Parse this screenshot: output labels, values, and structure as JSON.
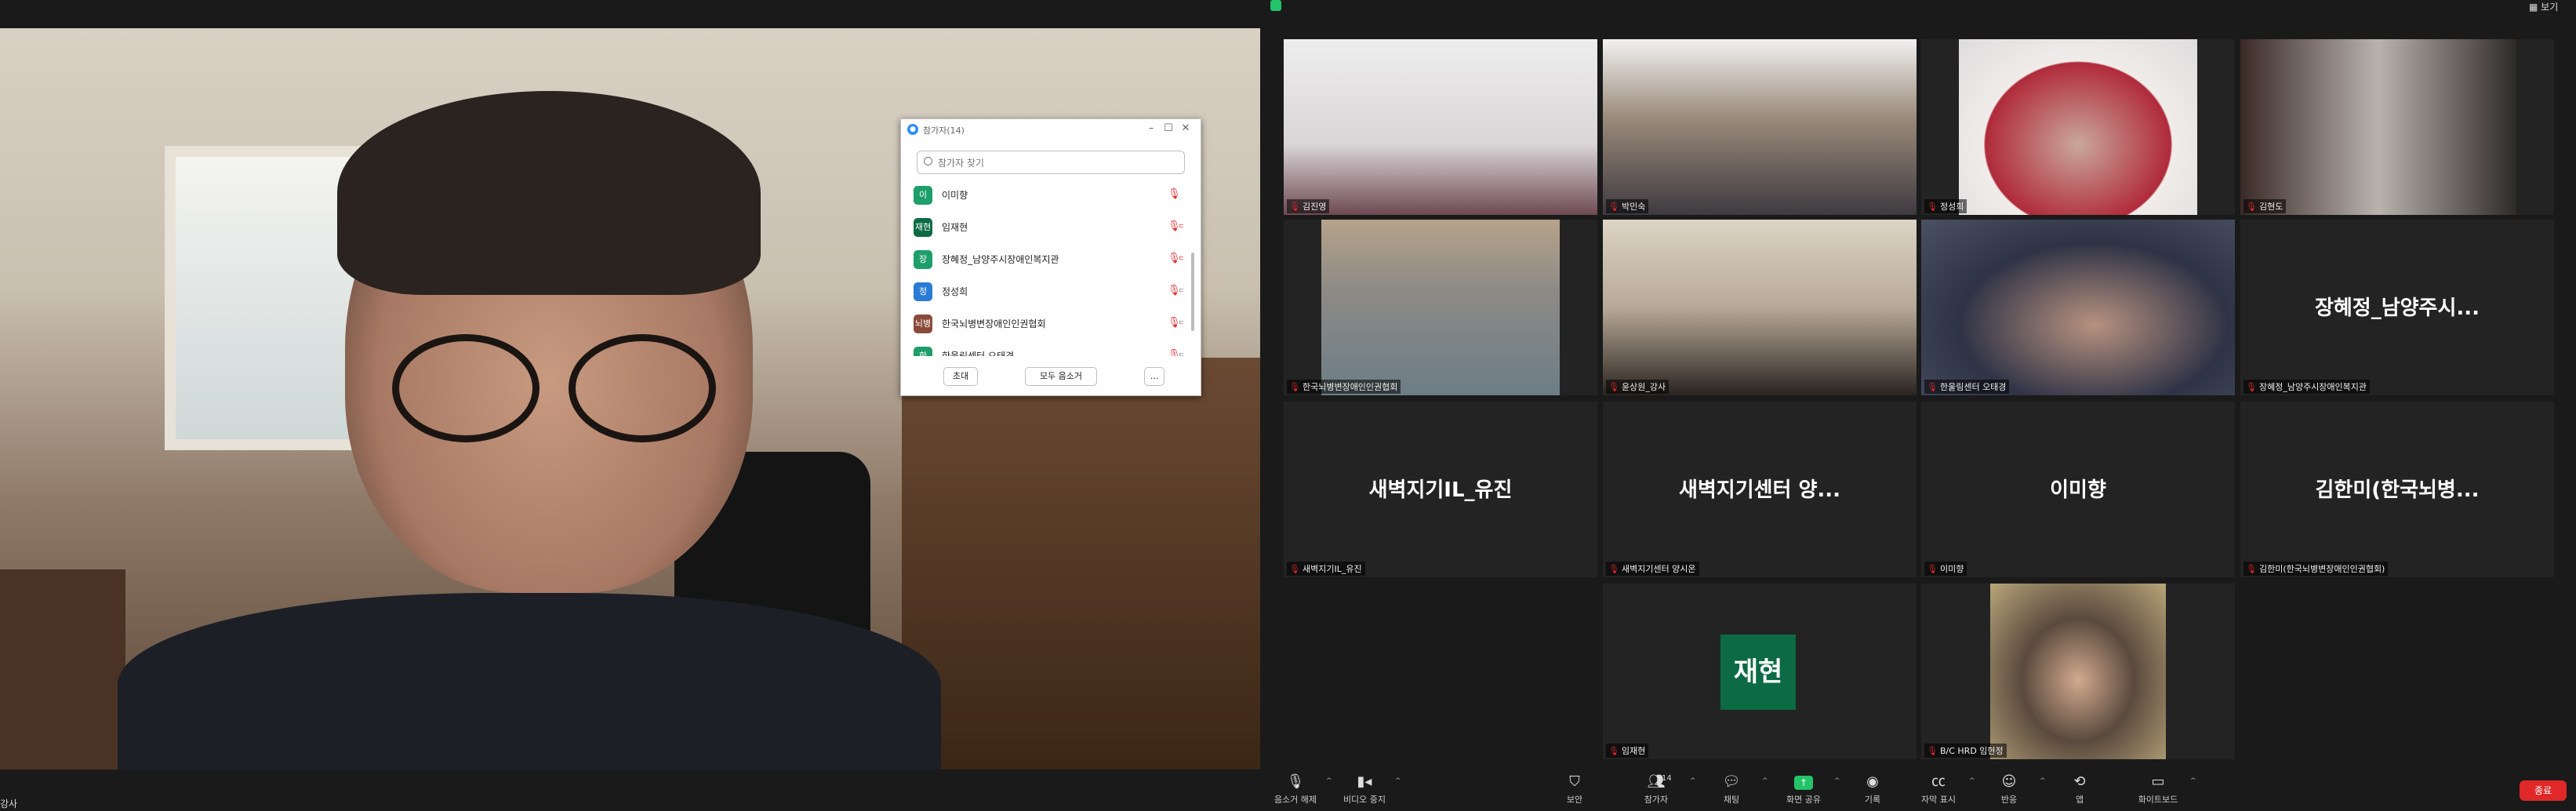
{
  "app": {
    "view_label": "보기"
  },
  "speaker": {
    "name_label": "강사"
  },
  "participants_panel": {
    "title": "참가자(14)",
    "search_placeholder": "참가자 찾기",
    "items": [
      {
        "initial": "이",
        "name": "이미향",
        "avatar_color": "#1e9e6a",
        "mic": "muted",
        "video": "none"
      },
      {
        "initial": "재현",
        "name": "임재현",
        "avatar_color": "#0c6b45",
        "mic": "muted",
        "video": "off"
      },
      {
        "initial": "장",
        "name": "장혜정_남양주시장애인복지관",
        "avatar_color": "#1e9e6a",
        "mic": "muted",
        "video": "off"
      },
      {
        "initial": "정",
        "name": "정성희",
        "avatar_color": "#2a7bd5",
        "mic": "muted",
        "video": "on"
      },
      {
        "initial": "뇌병",
        "name": "한국뇌병변장애인인권협회",
        "avatar_color": "#8a4a3a",
        "mic": "muted",
        "video": "on"
      },
      {
        "initial": "한",
        "name": "한울림센터 오태경",
        "avatar_color": "#1e9e6a",
        "mic": "muted",
        "video": "on"
      }
    ],
    "invite_label": "초대",
    "mute_all_label": "모두 음소거",
    "more_label": "..."
  },
  "gallery": [
    {
      "name": "김진영",
      "type": "video",
      "active": false
    },
    {
      "name": "박민숙",
      "type": "video",
      "active": false
    },
    {
      "name": "정성희",
      "type": "video",
      "active": false
    },
    {
      "name": "김현도",
      "type": "video",
      "active": false
    },
    {
      "name": "한국뇌병변장애인인권협회",
      "type": "video",
      "active": false
    },
    {
      "name": "윤상원_강사",
      "type": "video",
      "active": true
    },
    {
      "name": "한울림센터 오태경",
      "type": "video",
      "active": false
    },
    {
      "name": "장혜정_남양주시장애인복지관",
      "display": "장혜정_남양주시...",
      "type": "name",
      "active": false
    },
    {
      "name": "새벽지기IL_유진",
      "display": "새벽지기IL_유진",
      "type": "name",
      "active": false
    },
    {
      "name": "새벽지기센터 양시온",
      "display": "새벽지기센터 양...",
      "type": "name",
      "active": false
    },
    {
      "name": "이미향",
      "display": "이미향",
      "type": "name",
      "active": false
    },
    {
      "name": "김한미(한국뇌병변장애인인권협회)",
      "display": "김한미(한국뇌병...",
      "type": "name",
      "active": false
    },
    {
      "name": "임재현",
      "display": "재현",
      "type": "avatar",
      "active": false
    },
    {
      "name": "B/C HRD 임현정",
      "type": "video",
      "active": false
    }
  ],
  "toolbar": {
    "unmute": "음소거 해제",
    "stop_video": "비디오 중지",
    "security": "보안",
    "participants": "참가자",
    "participants_count": "14",
    "chat": "채팅",
    "share_screen": "화면 공유",
    "record": "기록",
    "captions": "자막 표시",
    "reactions": "반응",
    "apps": "앱",
    "whiteboard": "화이트보드",
    "end": "종료"
  },
  "colors": {
    "accent_green": "#23c36a",
    "end_red": "#e02828",
    "active_speaker": "#d7e55a"
  }
}
